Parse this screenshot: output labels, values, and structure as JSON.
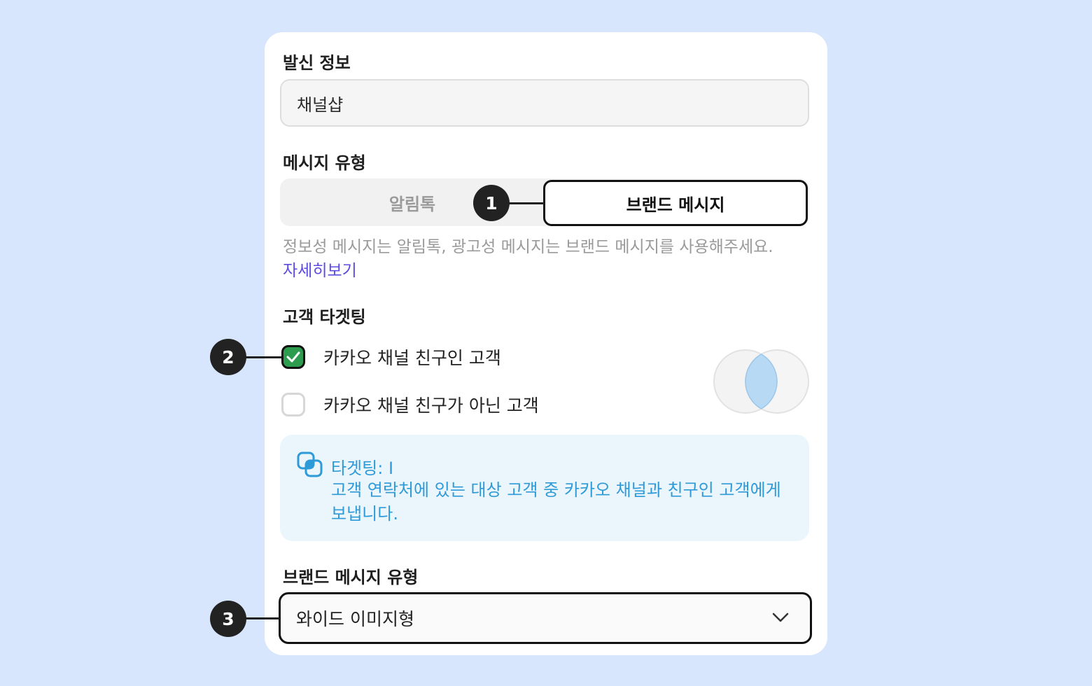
{
  "sender": {
    "label": "발신 정보",
    "value": "채널샵"
  },
  "message_type": {
    "label": "메시지 유형",
    "options": [
      "알림톡",
      "브랜드 메시지"
    ],
    "selected": "브랜드 메시지",
    "helper": "정보성 메시지는 알림톡, 광고성 메시지는 브랜드 메시지를 사용해주세요.",
    "link": "자세히보기"
  },
  "targeting": {
    "label": "고객 타겟팅",
    "options": [
      {
        "label": "카카오 채널 친구인 고객",
        "checked": true
      },
      {
        "label": "카카오 채널 친구가 아닌 고객",
        "checked": false
      }
    ],
    "info_title": "타겟팅: I",
    "info_body": "고객 연락처에 있는 대상 고객 중 카카오 채널과 친구인 고객에게 보냅니다."
  },
  "brand_message_type": {
    "label": "브랜드 메시지 유형",
    "value": "와이드 이미지형"
  },
  "markers": [
    "1",
    "2",
    "3"
  ],
  "colors": {
    "background": "#d8e6fd",
    "check_green": "#2e9c4e",
    "info_text": "#2f9ad8",
    "info_bg": "#eaf5fc",
    "link": "#5b4ce0"
  }
}
